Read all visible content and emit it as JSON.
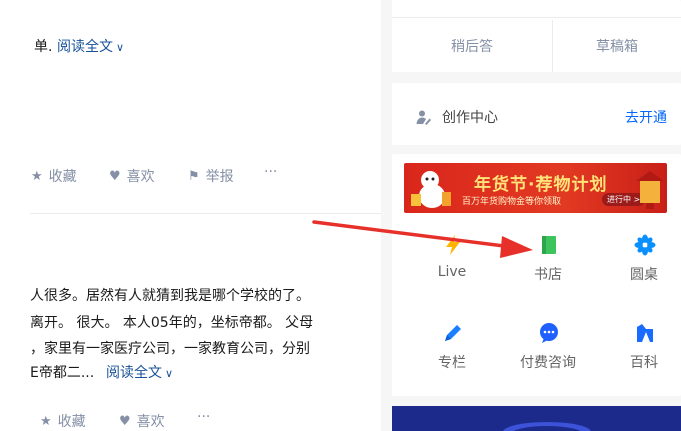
{
  "feed": {
    "answer1": {
      "snippet_tail": "单.",
      "read_more": "阅读全文",
      "actions": {
        "favorite": "收藏",
        "like": "喜欢",
        "report": "举报",
        "more": "···"
      }
    },
    "answer2": {
      "lines": [
        "人很多。居然有人就猜到我是哪个学校的了。",
        "离开。 很大。 本人05年的，坐标帝都。 父母",
        "，家里有一家医疗公司，一家教育公司，分别",
        "E帝都二..."
      ],
      "read_more": "阅读全文",
      "actions": {
        "favorite": "收藏",
        "like": "喜欢",
        "more": "···"
      }
    }
  },
  "sidebar": {
    "answer_tabs": {
      "later": "稍后答",
      "drafts": "草稿箱"
    },
    "creator": {
      "label": "创作中心",
      "link": "去开通"
    },
    "banner": {
      "title": "年货节·荐物计划",
      "subtitle": "百万年货购物金等你领取",
      "button": "进行中 >"
    },
    "grid": [
      {
        "label": "Live",
        "icon": "lightning-icon",
        "color": "#ffb400"
      },
      {
        "label": "书店",
        "icon": "book-icon",
        "color": "#3ec45c"
      },
      {
        "label": "圆桌",
        "icon": "pinwheel-icon",
        "color": "#0a8fff"
      },
      {
        "label": "专栏",
        "icon": "pen-icon",
        "color": "#1a7fff"
      },
      {
        "label": "付费咨询",
        "icon": "chat-bubble-icon",
        "color": "#2060ff"
      },
      {
        "label": "百科",
        "icon": "encyclopedia-icon",
        "color": "#1a6bff"
      }
    ],
    "accent_colors": {
      "link": "#0066ff",
      "read_more": "#175199",
      "muted": "#8590a6",
      "arrow": "#e8302a"
    }
  }
}
